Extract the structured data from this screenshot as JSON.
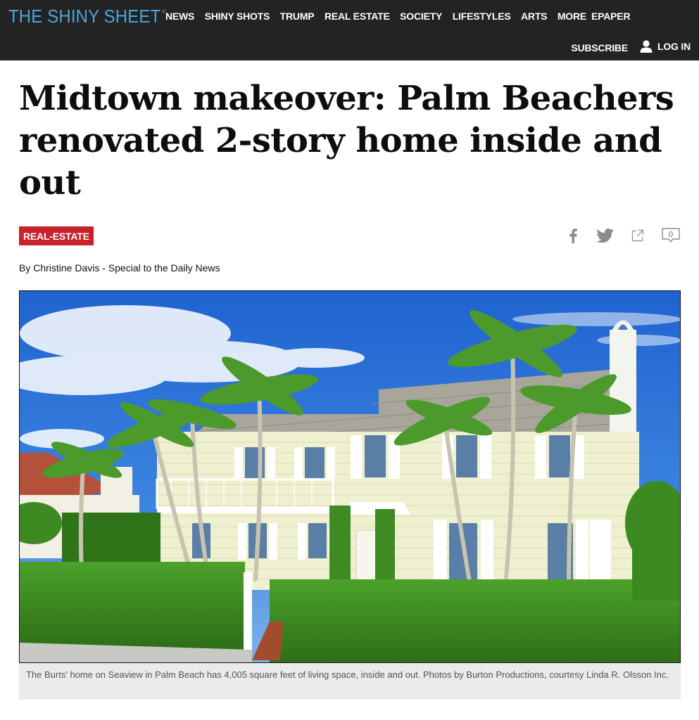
{
  "site": {
    "logo_text": "THE SHINY SHEET",
    "logo_mark": "®",
    "brand_color": "#4fa3d9",
    "nav_bg": "#232323"
  },
  "nav": {
    "items": [
      "NEWS",
      "SHINY SHOTS",
      "TRUMP",
      "REAL ESTATE",
      "SOCIETY",
      "LIFESTYLES",
      "ARTS",
      "MORE",
      "EPAPER"
    ]
  },
  "account": {
    "subscribe_label": "SUBSCRIBE",
    "login_label": "LOG IN",
    "login_icon": "user-icon"
  },
  "article": {
    "headline": "Midtown makeover: Palm Beachers renovated 2-story home inside and out",
    "category": "REAL-ESTATE",
    "category_color": "#c8212b",
    "byline": "By Christine Davis - Special to the Daily News",
    "comment_count": "0",
    "share_icons": [
      "facebook-icon",
      "twitter-icon",
      "share-icon",
      "comment-icon"
    ],
    "photo_caption": "The Burts' home on Seaview in Palm Beach has 4,005 square feet of living space, inside and out. Photos by Burton Productions, courtesy Linda R. Olsson Inc."
  }
}
